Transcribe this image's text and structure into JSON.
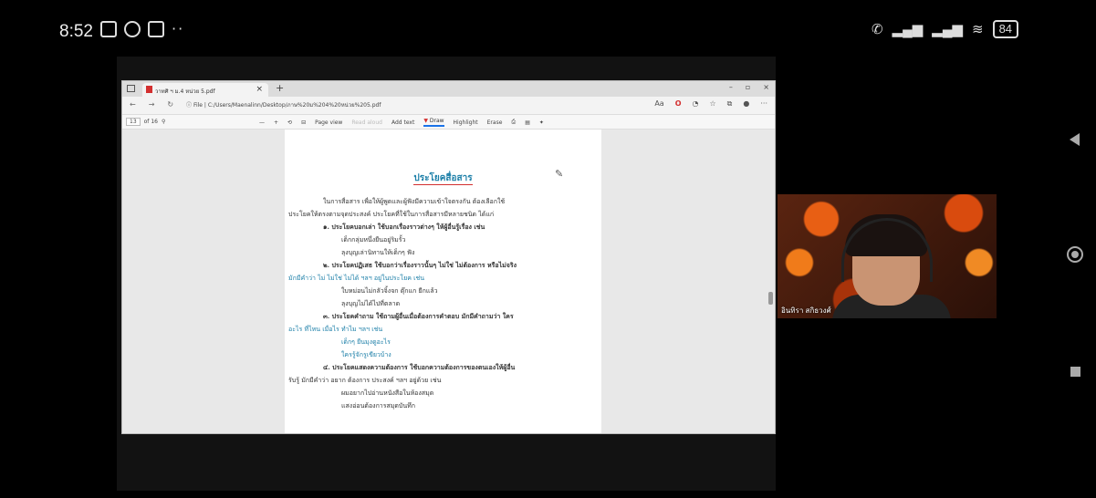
{
  "status_bar": {
    "time": "8:52",
    "left_icons": [
      "document-icon",
      "app-icon",
      "message-icon"
    ],
    "more": "··",
    "right_icons": [
      "wifi-calling-icon",
      "signal-icon",
      "signal-icon",
      "wifi-icon"
    ],
    "battery": "84"
  },
  "browser": {
    "tab_title": "วาทศิ ฯ ม.4 หน่วย 5.pdf",
    "url_prefix": "File",
    "url": "C:/Users/Maenalinn/Desktop/ภาษ%20ม%204%20หน่วย%205.pdf",
    "pdf_toolbar": {
      "page_current": "13",
      "page_total": "of 16",
      "zoom_out": "—",
      "zoom_in": "+",
      "page_view": "Page view",
      "read_aloud": "Read aloud",
      "add_text": "Add text",
      "draw": "Draw",
      "highlight": "Highlight",
      "erase": "Erase"
    }
  },
  "document": {
    "title": "ประโยคสื่อสาร",
    "lines": [
      "ในการสื่อสาร  เพื่อให้ผู้พูดและผู้ฟังมีความเข้าใจตรงกัน  ต้องเลือกใช้",
      "ประโยคให้ตรงตามจุดประสงค์  ประโยคที่ใช้ในการสื่อสารมีหลายชนิด ได้แก่",
      "๑. ประโยคบอกเล่า ใช้บอกเรื่องราวต่างๆ ให้ผู้อื่นรู้เรื่อง  เช่น",
      "เด็กกลุ่มหนึ่งยืนอยู่ริมรั้ว",
      "ลุงบุญเล่านิทานให้เด็กๆ ฟัง",
      "๒. ประโยคปฏิเสธ ใช้บอกว่าเรื่องราวนั้นๆ ไม่ใช่ ไม่ต้องการ หรือไม่จริง",
      "มักมีคำว่า  ไม่  ไม่ใช่  ไม่ได้  ฯลฯ  อยู่ในประโยค  เช่น",
      "ใบหม่อนไม่กลัวจิ้งจก  ตุ๊กแก  ยีกแล้ว",
      "ลุงบุญไม่ได้ไปที่ตลาด",
      "๓. ประโยคคำถาม ใช้ถามผู้อื่นเมื่อต้องการคำตอบ มักมีคำถามว่า ใคร",
      "อะไร  ที่ไหน  เมื่อไร  ทำไม  ฯลฯ  เช่น",
      "เด็กๆ ยืนมุงดูอะไร",
      "ใครรู้จักรูเขียวบ้าง",
      "๔. ประโยคแสดงความต้องการ ใช้บอกความต้องการของตนเองให้ผู้อื่น",
      "รับรู้  มักมีคำว่า  อยาก  ต้องการ  ประสงค์  ฯลฯ  อยู่ด้วย  เช่น",
      "ผมอยากไปอ่านหนังสือในห้องสมุด",
      "แสงอ่อนต้องการสมุดบันทึก"
    ]
  },
  "video": {
    "participant_name": "อินทิรา สกิธวงศ์"
  }
}
